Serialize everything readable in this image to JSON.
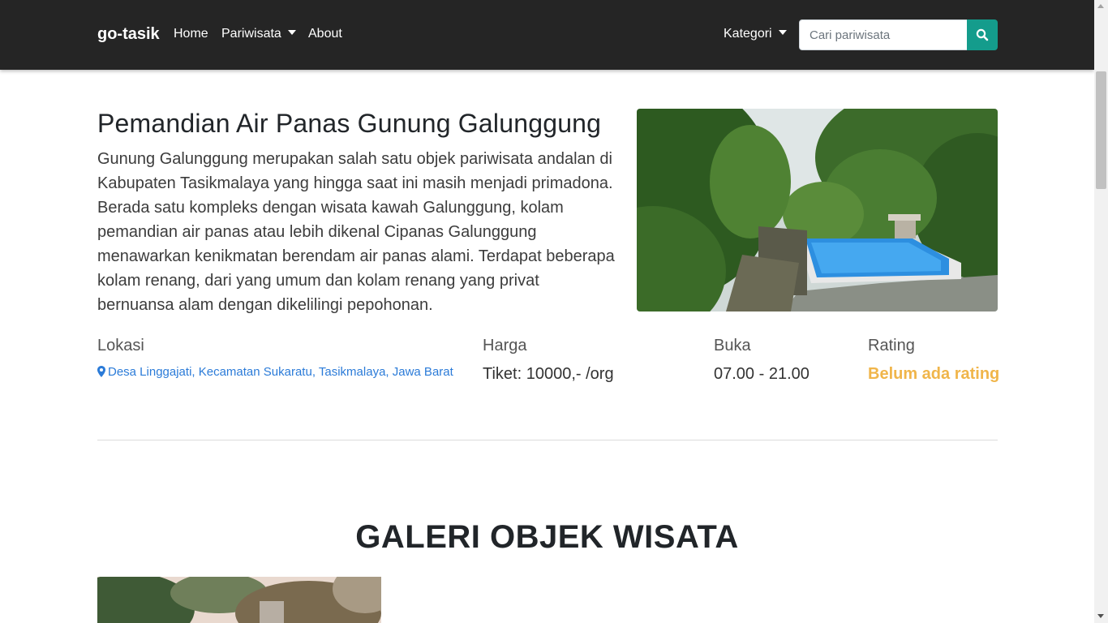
{
  "navbar": {
    "brand": "go-tasik",
    "links": {
      "home": "Home",
      "pariwisata": "Pariwisata",
      "about": "About"
    },
    "kategori": "Kategori",
    "search_placeholder": "Cari pariwisata",
    "search_icon": "search-icon",
    "accent_color": "#149c8c"
  },
  "main": {
    "title": "Pemandian Air Panas Gunung Galunggung",
    "description": "Gunung Galunggung merupakan salah satu objek pariwisata andalan di Kabupaten Tasikmalaya yang hingga saat ini masih menjadi primadona. Berada satu kompleks dengan wisata kawah Galunggung, kolam pemandian air panas atau lebih dikenal Cipanas Galunggung menawarkan kenikmatan berendam air panas alami. Terdapat beberapa kolam renang, dari yang umum dan kolam renang yang privat bernuansa alam dengan dikelilingi pepohonan.",
    "info": {
      "lokasi_label": "Lokasi",
      "lokasi_value": "Desa Linggajati, Kecamatan Sukaratu, Tasikmalaya, Jawa Barat",
      "lokasi_icon": "map-marker-icon",
      "harga_label": "Harga",
      "harga_value": "Tiket: 10000,- /org",
      "buka_label": "Buka",
      "buka_value": "07.00 - 21.00",
      "rating_label": "Rating",
      "rating_value": "Belum ada rating",
      "rating_color": "#f0b54a"
    }
  },
  "gallery": {
    "heading": "GALERI OBJEK WISATA"
  }
}
